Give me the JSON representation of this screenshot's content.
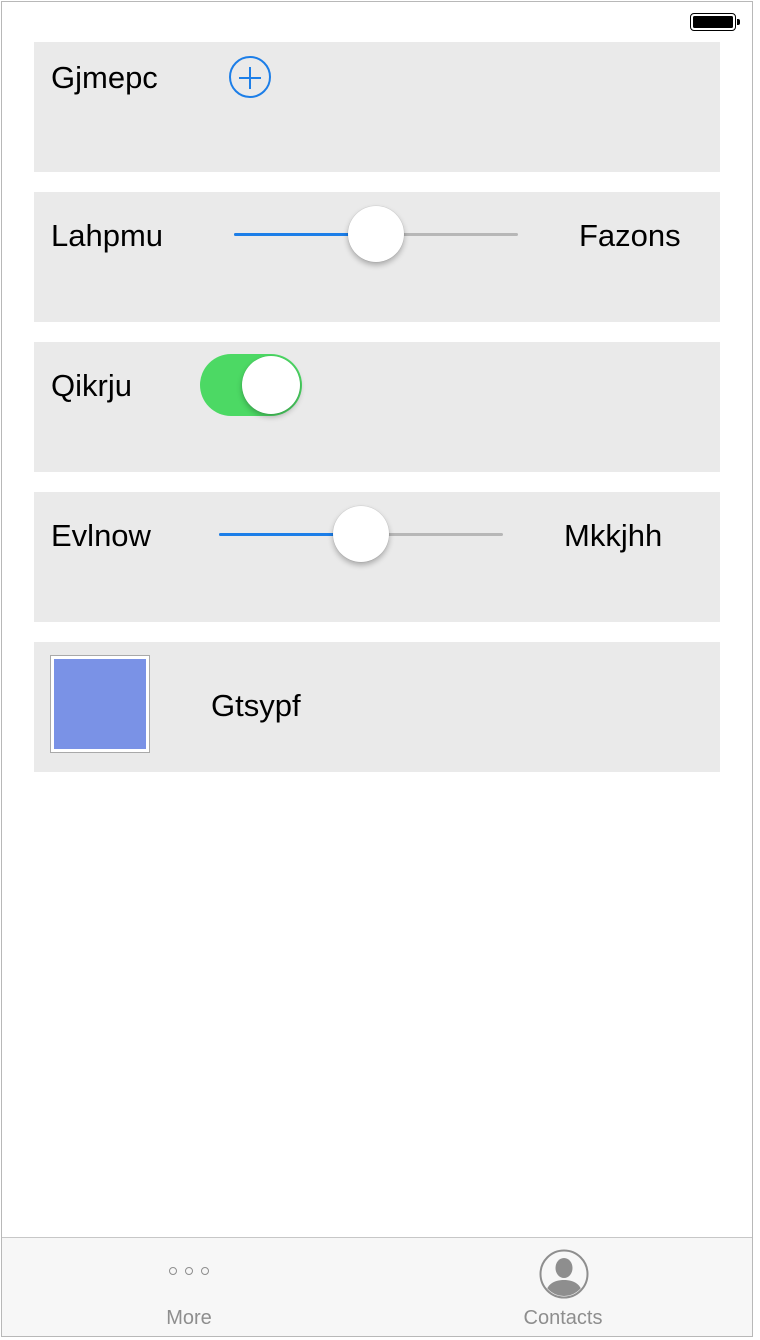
{
  "rows": {
    "gjmepc": {
      "label": "Gjmepc"
    },
    "lahpmu": {
      "label": "Lahpmu",
      "right_label": "Fazons",
      "value": 0.5
    },
    "qikrju": {
      "label": "Qikrju",
      "on": true
    },
    "evlnow": {
      "label": "Evlnow",
      "right_label": "Mkkjhh",
      "value": 0.5
    },
    "gtsypf": {
      "label": "Gtsypf",
      "swatch_color": "#7a92e6"
    }
  },
  "tabbar": {
    "tabs": [
      {
        "label": "More",
        "icon": "more-icon"
      },
      {
        "label": "Contacts",
        "icon": "contacts-icon"
      }
    ]
  },
  "colors": {
    "accent": "#1c7ee8",
    "toggle_on": "#4cd964",
    "row_bg": "#eaeaea"
  }
}
